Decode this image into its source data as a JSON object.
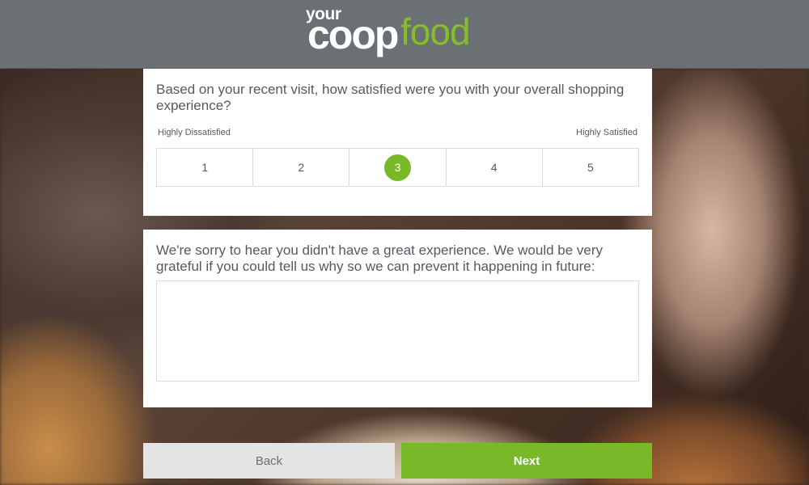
{
  "brand": {
    "logo_your": "your",
    "logo_coop": "coop",
    "logo_food": "food"
  },
  "satisfaction": {
    "question": "Based on your recent visit, how satisfied were you with your overall shopping experience?",
    "low_label": "Highly Dissatisfied",
    "high_label": "Highly Satisfied",
    "options": [
      "1",
      "2",
      "3",
      "4",
      "5"
    ],
    "selected": "3"
  },
  "feedback": {
    "prompt": "We're sorry to hear you didn't have a great experience. We would be very grateful if you could tell us why so we can prevent it happening in future:",
    "value": "",
    "placeholder": ""
  },
  "actions": {
    "back_label": "Back",
    "next_label": "Next"
  },
  "colors": {
    "accent": "#78b829",
    "header": "#6b7075",
    "text": "#555a60"
  }
}
